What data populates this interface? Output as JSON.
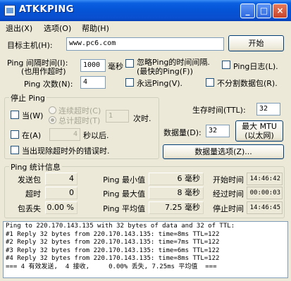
{
  "window": {
    "title": "ATKKPING",
    "min": "_",
    "max": "□",
    "close": "×"
  },
  "menu": [
    "退出(X)",
    "选项(O)",
    "帮助(H)"
  ],
  "target": {
    "label": "目标主机(H):",
    "value": "www.pc6.com",
    "start_button": "开始"
  },
  "interval": {
    "label_line1": "Ping 间隔时间(I):",
    "label_line2": "(也用作超时)",
    "value": "1000",
    "unit": "毫秒"
  },
  "options": {
    "ignore_ping_time": "忽略Ping的时间间隔.",
    "ignore_ping_time_sub": "(最快的Ping(F))",
    "ping_log": "Ping日志(L).",
    "forever_ping": "永远Ping(V).",
    "no_split_packets": "不分割数据包(R)."
  },
  "ping_count": {
    "label": "Ping 次数(N):",
    "value": "4"
  },
  "stop_ping": {
    "title": "停止 Ping",
    "when": "当(W)",
    "consecutive_timeout": "连续超时(C)",
    "total_timeout": "总计超时(T)",
    "timeout_count": "1",
    "times": "次时.",
    "at": "在(A)",
    "at_value": "4",
    "seconds_after": "秒以后.",
    "on_timeout_error": "当出现除超时外的错误时."
  },
  "ttl": {
    "label": "生存时间(TTL):",
    "value": "32"
  },
  "data_size": {
    "label": "数据量(D):",
    "value": "32",
    "max_mtu_line1": "最大 MTU",
    "max_mtu_line2": "(以太网)",
    "options_button": "数据量选项(Z)..."
  },
  "stats": {
    "title": "Ping  统计信息",
    "rows": [
      {
        "label": "发送包",
        "value": "4",
        "mlabel": "Ping 最小值",
        "mvalue": "6 毫秒",
        "tlabel": "开始时间",
        "tvalue": "14:46:42"
      },
      {
        "label": "超时",
        "value": "0",
        "mlabel": "Ping 最大值",
        "mvalue": "8 毫秒",
        "tlabel": "经过时间",
        "tvalue": "00:00:03"
      },
      {
        "label": "包丢失",
        "value": "0.00 %",
        "mlabel": "Ping 平均值",
        "mvalue": "7.25 毫秒",
        "tlabel": "停止时间",
        "tvalue": "14:46:45"
      }
    ]
  },
  "output_lines": [
    "Ping to 220.170.143.135 with 32 bytes of data and 32 of TTL:",
    "#1 Reply 32 bytes from 220.170.143.135: time=8ms TTL=122",
    "#2 Reply 32 bytes from 220.170.143.135: time=7ms TTL=122",
    "#3 Reply 32 bytes from 220.170.143.135: time=6ms TTL=122",
    "#4 Reply 32 bytes from 220.170.143.135: time=8ms TTL=122",
    "=== 4 有效发送,  4 接收,     0.00% 丢失, 7.25ms 平均值  ==="
  ]
}
